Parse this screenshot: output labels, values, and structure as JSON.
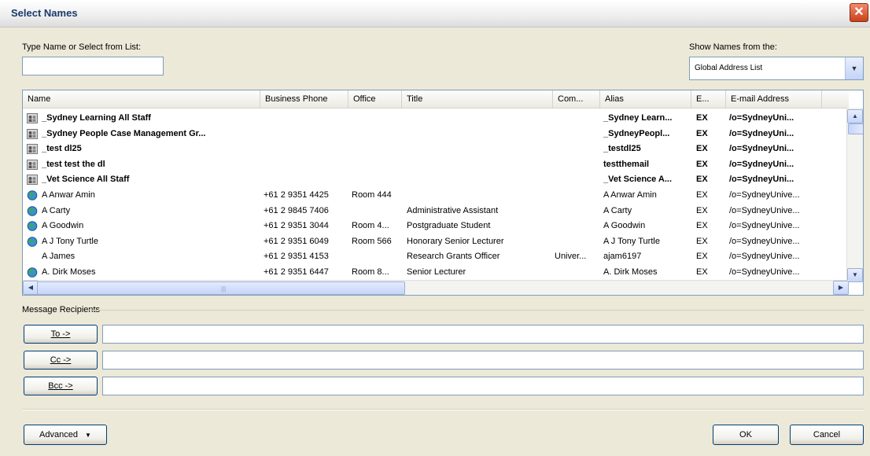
{
  "window": {
    "title": "Select Names",
    "close": "✕"
  },
  "search": {
    "label": "Type Name or Select from List:",
    "value": ""
  },
  "source": {
    "label": "Show Names from the:",
    "selected": "Global Address List"
  },
  "columns": [
    "Name",
    "Business Phone",
    "Office",
    "Title",
    "Com...",
    "Alias",
    "E...",
    "E-mail Address"
  ],
  "rows": [
    {
      "icon": "group",
      "bold": true,
      "name": "_Sydney Learning All Staff",
      "phone": "",
      "office": "",
      "title": "",
      "company": "",
      "alias": "_Sydney Learn...",
      "type": "EX",
      "email": "/o=SydneyUni..."
    },
    {
      "icon": "group",
      "bold": true,
      "name": "_Sydney People Case Management Gr...",
      "phone": "",
      "office": "",
      "title": "",
      "company": "",
      "alias": "_SydneyPeopl...",
      "type": "EX",
      "email": "/o=SydneyUni..."
    },
    {
      "icon": "group",
      "bold": true,
      "name": "_test dl25",
      "phone": "",
      "office": "",
      "title": "",
      "company": "",
      "alias": "_testdl25",
      "type": "EX",
      "email": "/o=SydneyUni..."
    },
    {
      "icon": "group",
      "bold": true,
      "name": "_test test the dl",
      "phone": "",
      "office": "",
      "title": "",
      "company": "",
      "alias": "testthemail",
      "type": "EX",
      "email": "/o=SydneyUni..."
    },
    {
      "icon": "group",
      "bold": true,
      "name": "_Vet Science All Staff",
      "phone": "",
      "office": "",
      "title": "",
      "company": "",
      "alias": "_Vet Science A...",
      "type": "EX",
      "email": "/o=SydneyUni..."
    },
    {
      "icon": "globe",
      "bold": false,
      "name": "A Anwar Amin",
      "phone": "+61 2 9351 4425",
      "office": "Room 444",
      "title": "",
      "company": "",
      "alias": "A Anwar Amin",
      "type": "EX",
      "email": "/o=SydneyUnive..."
    },
    {
      "icon": "globe",
      "bold": false,
      "name": "A Carty",
      "phone": "+61 2 9845 7406",
      "office": "",
      "title": "Administrative Assistant",
      "company": "",
      "alias": "A Carty",
      "type": "EX",
      "email": "/o=SydneyUnive..."
    },
    {
      "icon": "globe",
      "bold": false,
      "name": "A Goodwin",
      "phone": "+61 2 9351 3044",
      "office": "Room 4...",
      "title": "Postgraduate Student",
      "company": "",
      "alias": "A Goodwin",
      "type": "EX",
      "email": "/o=SydneyUnive..."
    },
    {
      "icon": "globe",
      "bold": false,
      "name": "A J Tony Turtle",
      "phone": "+61 2 9351 6049",
      "office": "Room 566",
      "title": "Honorary Senior Lecturer",
      "company": "",
      "alias": "A J Tony Turtle",
      "type": "EX",
      "email": "/o=SydneyUnive..."
    },
    {
      "icon": "none",
      "bold": false,
      "name": "A James",
      "phone": "+61 2 9351 4153",
      "office": "",
      "title": "Research Grants Officer",
      "company": "Univer...",
      "alias": "ajam6197",
      "type": "EX",
      "email": "/o=SydneyUnive..."
    },
    {
      "icon": "globe",
      "bold": false,
      "name": "A. Dirk Moses",
      "phone": "+61 2 9351 6447",
      "office": "Room 8...",
      "title": "Senior Lecturer",
      "company": "",
      "alias": "A. Dirk Moses",
      "type": "EX",
      "email": "/o=SydneyUnive..."
    }
  ],
  "recipients": {
    "label": "Message Recipients",
    "to_label": "To ->",
    "cc_label": "Cc ->",
    "bcc_label": "Bcc ->",
    "to_value": "",
    "cc_value": "",
    "bcc_value": ""
  },
  "footer": {
    "advanced_label": "Advanced",
    "ok_label": "OK",
    "cancel_label": "Cancel"
  }
}
